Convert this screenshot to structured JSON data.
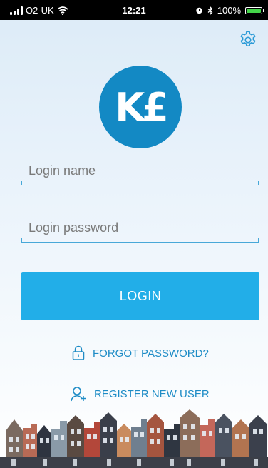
{
  "status_bar": {
    "carrier": "O2-UK",
    "time": "12:21",
    "battery": "100%",
    "battery_level": 1.0
  },
  "header": {
    "settings_icon": "gear-icon"
  },
  "logo": {
    "text": "K£",
    "color": "#1389c4"
  },
  "form": {
    "login_name": {
      "placeholder": "Login name",
      "value": ""
    },
    "login_password": {
      "placeholder": "Login password",
      "value": ""
    },
    "login_button": "LOGIN"
  },
  "links": {
    "forgot_password": "FORGOT PASSWORD?",
    "forgot_password_icon": "lock-icon",
    "register": "REGISTER NEW USER",
    "register_icon": "user-add-icon"
  },
  "colors": {
    "accent": "#22aee8",
    "link": "#1e8cc6",
    "field_line": "#47a8d8"
  }
}
